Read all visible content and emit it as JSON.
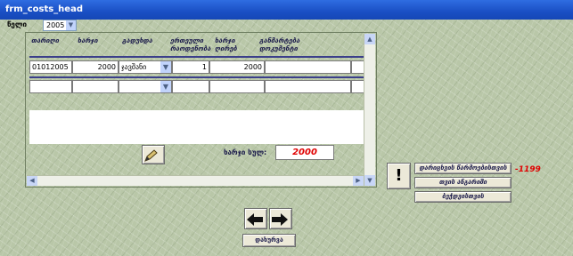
{
  "window": {
    "title": "frm_costs_head"
  },
  "year_filter": {
    "label": "წელი",
    "value": "2005"
  },
  "columns": [
    "თარიღი",
    "ხარჯი",
    "გადუხდა",
    "ერთეული რაოდენობა",
    "ხარჯი ღირებ",
    "განმარტება დოკუმენტი"
  ],
  "rows": [
    {
      "date": "01012005",
      "amount": "2000",
      "paid": "ჯავშანი",
      "qty": "1",
      "sum": "2000",
      "note": ""
    },
    {
      "date": "",
      "amount": "",
      "paid": "",
      "qty": "",
      "sum": "",
      "note": ""
    }
  ],
  "total": {
    "label": "ხარჯი სულ:",
    "value": "2000"
  },
  "buttons": {
    "recalc": "დარიცხვის წარმოებისთვის",
    "year_report": "თვის ანგარიში",
    "print": "ბეჭდვისთვის",
    "close": "დახურვა",
    "exclaim": "!"
  },
  "result_value": "-1199",
  "icons": {
    "edit": "edit-pen-icon",
    "prev": "arrow-left-icon",
    "next": "arrow-right-icon"
  }
}
